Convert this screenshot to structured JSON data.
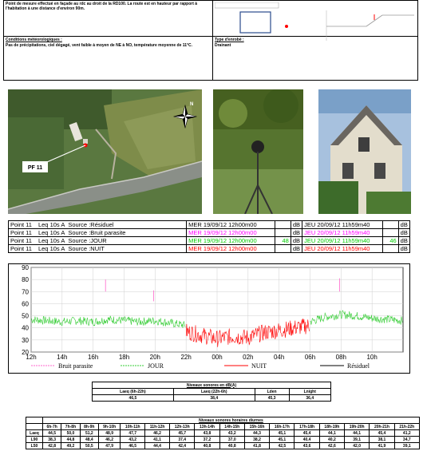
{
  "info": {
    "description_text": "Point de mesure effectué en façade au rdc au droit de la RD100. La route est en hauteur par rapport à l'habitation à une distance d'environ 90m.",
    "meteo_label": "Conditions météorologiques :",
    "meteo_text": "Pas de précipitations, ciel dégagé, vent faible à moyen de NE à NO, température moyenne de 11°C.",
    "enrobe_label": "Type d'enrobé :",
    "enrobe_value": "Drainant"
  },
  "aerial": {
    "point_label": "PF 11",
    "north_label": "N"
  },
  "sources": {
    "rows": [
      {
        "point": "Point 11",
        "metric": "Leq 10s  A",
        "source": "Source :Résiduel",
        "start": "MER 19/09/12 12h00m00",
        "start_val": "",
        "unit1": "dB",
        "end": "JEU 20/09/12 11h59m40",
        "end_val": "",
        "unit2": "dB",
        "color": "#000000"
      },
      {
        "point": "Point 11",
        "metric": "Leq 10s  A",
        "source": "Source :Bruit parasite",
        "start": "MER 19/09/12 12h00m00",
        "start_val": "",
        "unit1": "dB",
        "end": "JEU 20/09/12 11h59m40",
        "end_val": "",
        "unit2": "dB",
        "color": "#ff00ff"
      },
      {
        "point": "Point 11",
        "metric": "Leq 10s  A",
        "source": "Source :JOUR",
        "start": "MER 19/09/12 12h00m00",
        "start_val": "48",
        "unit1": "dB",
        "end": "JEU 20/09/12 11h59m40",
        "end_val": "46",
        "unit2": "dB",
        "color": "#00cc00"
      },
      {
        "point": "Point 11",
        "metric": "Leq 10s  A",
        "source": "Source :NUIT",
        "start": "MER 19/09/12 12h00m00",
        "start_val": "",
        "unit1": "dB",
        "end": "JEU 20/09/12 11h59m40",
        "end_val": "",
        "unit2": "dB",
        "color": "#ff0000"
      }
    ]
  },
  "chart_data": {
    "type": "line",
    "ylim": [
      20,
      90
    ],
    "yticks": [
      "90",
      "80",
      "70",
      "60",
      "50",
      "40",
      "30",
      "20"
    ],
    "xticks": [
      "12h",
      "14h",
      "16h",
      "18h",
      "20h",
      "22h",
      "00h",
      "02h",
      "04h",
      "06h",
      "08h",
      "10h"
    ],
    "xlim_hours": [
      12,
      36
    ],
    "series": [
      {
        "name": "Bruit parasite",
        "color": "#ff66cc",
        "segments": [
          [
            [
              16.8,
              80
            ],
            [
              16.8,
              70
            ]
          ],
          [
            [
              19.9,
              71
            ],
            [
              19.9,
              62
            ]
          ],
          [
            [
              31.9,
              81
            ],
            [
              31.9,
              70
            ]
          ]
        ]
      },
      {
        "name": "JOUR",
        "color": "#33cc33",
        "x": [
          12,
          13,
          14,
          15,
          16,
          17,
          18,
          19,
          20,
          21,
          22,
          30,
          31,
          32,
          33,
          34,
          35,
          36
        ],
        "y": [
          47,
          46,
          45,
          46,
          45,
          47,
          46,
          45,
          46,
          44,
          42,
          45,
          49,
          51,
          50,
          48,
          47,
          46
        ]
      },
      {
        "name": "NUIT",
        "color": "#ff0000",
        "x": [
          22,
          23,
          24,
          25,
          26,
          27,
          28,
          29,
          30
        ],
        "y": [
          37,
          34,
          31,
          33,
          32,
          36,
          38,
          40,
          42
        ]
      },
      {
        "name": "Résiduel",
        "color": "#000000",
        "x": [],
        "y": []
      }
    ]
  },
  "niveaux": {
    "title": "Niveaux sonores en dB(A)",
    "headers": [
      "Laeq (6h-22h)",
      "Laeq (22h-6h)",
      "Lden",
      "Lnight"
    ],
    "values": [
      "46,5",
      "38,4",
      "45,3",
      "36,4"
    ]
  },
  "horaires": {
    "title": "Niveaux sonores horaires diurnes",
    "columns": [
      "6h-7h",
      "7h-8h",
      "8h-9h",
      "9h-10h",
      "10h-11h",
      "11h-12h",
      "12h-13h",
      "13h-14h",
      "14h-15h",
      "15h-16h",
      "16h-17h",
      "17h-18h",
      "18h-19h",
      "19h-20h",
      "20h-21h",
      "21h-22h"
    ],
    "rows": [
      {
        "label": "Laeq",
        "values": [
          "44,5",
          "50,0",
          "51,2",
          "48,9",
          "47,7",
          "46,2",
          "45,7",
          "43,8",
          "43,2",
          "44,3",
          "45,1",
          "45,4",
          "44,1",
          "44,1",
          "45,4",
          "41,2"
        ]
      },
      {
        "label": "L90",
        "values": [
          "38,3",
          "44,8",
          "48,4",
          "46,2",
          "43,2",
          "41,1",
          "37,4",
          "37,2",
          "37,0",
          "38,2",
          "45,1",
          "40,4",
          "40,2",
          "39,1",
          "38,1",
          "34,7"
        ]
      },
      {
        "label": "L50",
        "values": [
          "42,8",
          "49,2",
          "50,5",
          "47,9",
          "46,5",
          "44,4",
          "42,4",
          "40,8",
          "40,8",
          "41,8",
          "42,5",
          "43,6",
          "42,6",
          "42,0",
          "41,9",
          "39,1"
        ]
      }
    ]
  }
}
